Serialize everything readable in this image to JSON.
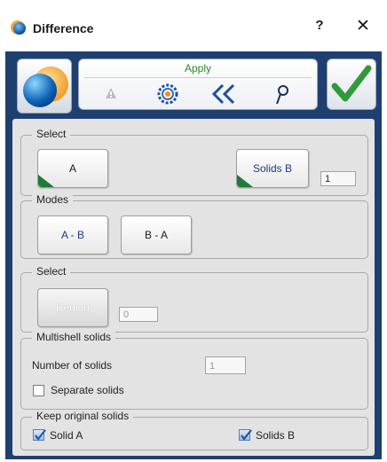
{
  "window": {
    "title": "Difference",
    "help": "?",
    "close": "✕"
  },
  "toolbar": {
    "apply_label": "Apply",
    "icons": [
      "warning-icon",
      "gear-icon",
      "double-chevron-left-icon",
      "probe-icon"
    ],
    "accent_green": "#2a8a2a"
  },
  "select_group": {
    "legend": "Select",
    "a_button": "A",
    "solids_b_button": "Solids B",
    "count_value": "1"
  },
  "modes_group": {
    "legend": "Modes",
    "a_minus_b": "A - B",
    "b_minus_a": "B - A"
  },
  "region_group": {
    "legend": "Select",
    "region_button": "Region",
    "region_count": "0"
  },
  "multishell_group": {
    "legend": "Multishell solids",
    "number_label": "Number of solids",
    "number_value": "1",
    "separate_label": "Separate solids",
    "separate_checked": false
  },
  "keep_group": {
    "legend": "Keep original solids",
    "solid_a_label": "Solid A",
    "solid_a_checked": true,
    "solids_b_label": "Solids B",
    "solids_b_checked": true
  }
}
